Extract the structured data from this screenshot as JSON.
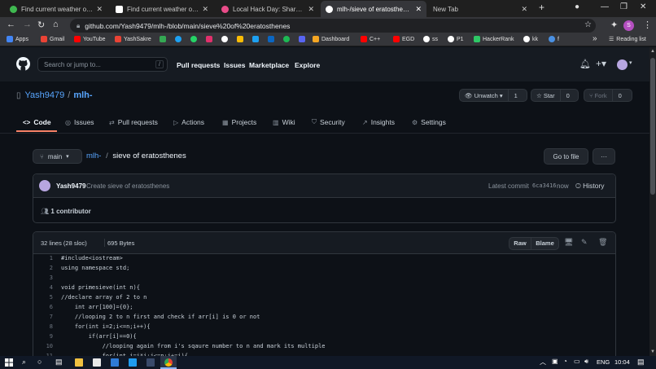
{
  "browser": {
    "tabs": [
      {
        "title": "Find current weather of any c",
        "favicon_color": "#3fb950",
        "active": false
      },
      {
        "title": "Find current weather of any c",
        "favicon_color": "#ffffff",
        "active": false
      },
      {
        "title": "Local Hack Day: Share - Chall",
        "favicon_color": "#e94c89",
        "active": false
      },
      {
        "title": "mlh-/sieve of eratosthenes at",
        "favicon_color": "#ffffff",
        "active": true
      },
      {
        "title": "New Tab",
        "favicon_color": "",
        "active": false
      }
    ],
    "new_tab_symbol": "+",
    "url": "github.com/Yash9479/mlh-/blob/main/sieve%20of%20eratosthenes",
    "profile_initial": "S",
    "bookmarks": [
      {
        "label": "Apps",
        "color": "#4285f4"
      },
      {
        "label": "Gmail",
        "color": "#ea4335"
      },
      {
        "label": "YouTube",
        "color": "#ff0000"
      },
      {
        "label": "YashSakre",
        "color": "#ea4335"
      },
      {
        "label": "",
        "color": "#34a853"
      },
      {
        "label": "",
        "color": "#1da1f2"
      },
      {
        "label": "",
        "color": "#25d366"
      },
      {
        "label": "",
        "color": "#e1306c"
      },
      {
        "label": "",
        "color": "#ffffff"
      },
      {
        "label": "",
        "color": "#fbbc05"
      },
      {
        "label": "",
        "color": "#1da1f2"
      },
      {
        "label": "",
        "color": "#0a66c2"
      },
      {
        "label": "",
        "color": "#1db954"
      },
      {
        "label": "",
        "color": "#5865f2"
      },
      {
        "label": "Dashboard",
        "color": "#f5a623"
      },
      {
        "label": "C++",
        "color": "#ff0000"
      },
      {
        "label": "EGD",
        "color": "#ff0000"
      },
      {
        "label": "ss",
        "color": "#ffffff"
      },
      {
        "label": "P1",
        "color": "#ffffff"
      },
      {
        "label": "HackerRank",
        "color": "#2ec866"
      },
      {
        "label": "kk",
        "color": "#ffffff"
      },
      {
        "label": "f",
        "color": "#4a90e2"
      }
    ],
    "bookmarks_more": "»",
    "reading_list": "Reading list"
  },
  "github": {
    "search_placeholder": "Search or jump to...",
    "search_key": "/",
    "nav": [
      "Pull requests",
      "Issues",
      "Marketplace",
      "Explore"
    ],
    "owner": "Yash9479",
    "repo": "mlh-",
    "separator": "/",
    "unwatch": {
      "label": "Unwatch",
      "count": "1"
    },
    "star": {
      "label": "Star",
      "count": "0"
    },
    "fork": {
      "label": "Fork",
      "count": "0"
    },
    "tabs": [
      "Code",
      "Issues",
      "Pull requests",
      "Actions",
      "Projects",
      "Wiki",
      "Security",
      "Insights",
      "Settings"
    ],
    "branch": "main",
    "crumb_repo": "mlh-",
    "crumb_sep": "/",
    "crumb_file": "sieve of eratosthenes",
    "go_to_file": "Go to file",
    "more_menu": "···",
    "commit": {
      "author": "Yash9479",
      "message": "Create sieve of eratosthenes",
      "latest_label": "Latest commit",
      "sha": "6ca3416",
      "when": "now",
      "history": "History"
    },
    "contributors": "1 contributor",
    "file_info": {
      "lines": "32 lines (28 sloc)",
      "size": "695 Bytes"
    },
    "raw": "Raw",
    "blame": "Blame",
    "code_lines": [
      {
        "n": "1",
        "text": "#include<iostream>"
      },
      {
        "n": "2",
        "text": "using namespace std;"
      },
      {
        "n": "3",
        "text": ""
      },
      {
        "n": "4",
        "text": "void primesieve(int n){"
      },
      {
        "n": "5",
        "text": "//declare array of 2 to n"
      },
      {
        "n": "6",
        "text": "    int arr[100]={0};"
      },
      {
        "n": "7",
        "text": "    //looping 2 to n first and check if arr[i] is 0 or not"
      },
      {
        "n": "8",
        "text": "    for(int i=2;i<=n;i++){"
      },
      {
        "n": "9",
        "text": "        if(arr[i]==0){"
      },
      {
        "n": "10",
        "text": "            //looping again from i's sqaure number to n and mark its multiple"
      },
      {
        "n": "11",
        "text": "            for(int j=i*i;j<=n;j+=i){"
      }
    ]
  },
  "taskbar": {
    "language": "ENG",
    "time": "10:04"
  }
}
